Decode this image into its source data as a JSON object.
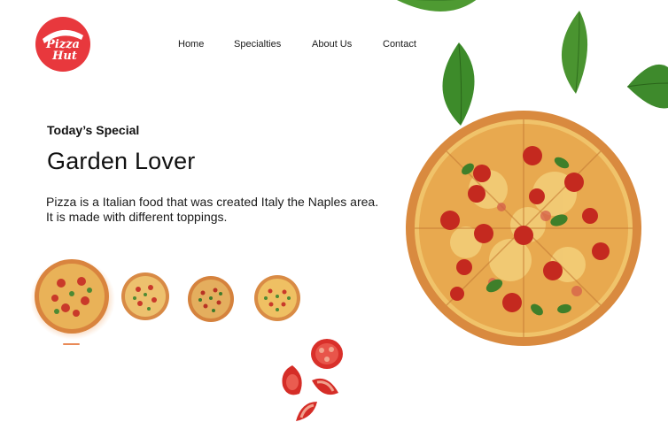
{
  "brand": {
    "logo_text_line1": "Pizza",
    "logo_text_line2": "Hut",
    "color": "#e8383d"
  },
  "nav": {
    "items": [
      {
        "label": "Home"
      },
      {
        "label": "Specialties"
      },
      {
        "label": "About Us"
      },
      {
        "label": "Contact"
      }
    ]
  },
  "hero": {
    "eyebrow": "Today’s Special",
    "title": "Garden Lover",
    "description": "Pizza is a Italian food that was created Italy the Naples area. It is made with different toppings."
  },
  "thumbnails": {
    "count": 4,
    "selected_index": 0,
    "accent": "#e98a57"
  },
  "icons": [
    "pizza-hut-logo",
    "basil-leaf-icon",
    "tomato-slice-icon",
    "pizza-image"
  ]
}
